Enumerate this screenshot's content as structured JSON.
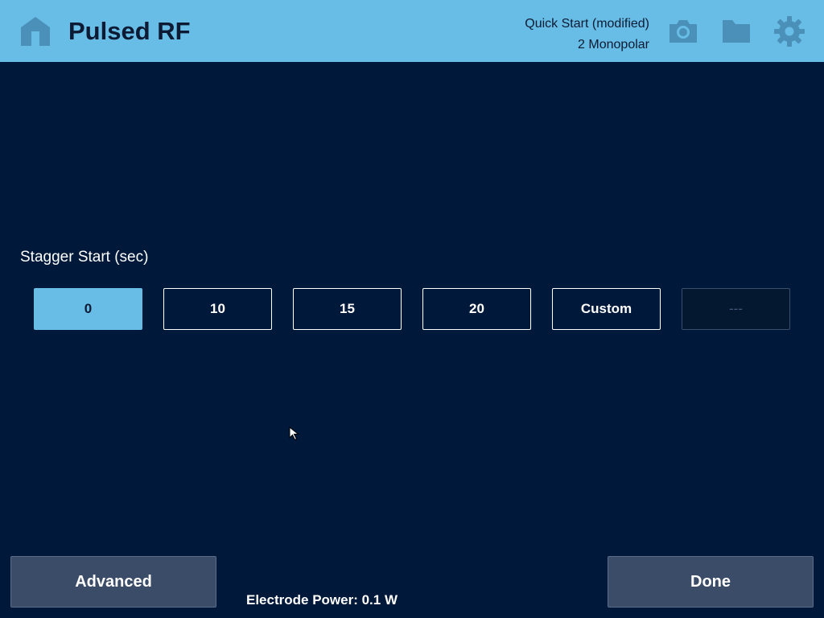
{
  "header": {
    "title": "Pulsed RF",
    "preset_name": "Quick Start (modified)",
    "preset_mode": "2 Monopolar",
    "icons": [
      "home-icon",
      "camera-icon",
      "folder-icon",
      "gear-icon"
    ],
    "background_color": "#67bde6"
  },
  "stagger": {
    "label": "Stagger Start (sec)",
    "options": [
      {
        "label": "0",
        "state": "selected"
      },
      {
        "label": "10",
        "state": "normal"
      },
      {
        "label": "15",
        "state": "normal"
      },
      {
        "label": "20",
        "state": "normal"
      },
      {
        "label": "Custom",
        "state": "normal"
      },
      {
        "label": "---",
        "state": "disabled"
      }
    ]
  },
  "footer": {
    "advanced_label": "Advanced",
    "done_label": "Done",
    "power_text": "Electrode Power: 0.1 W"
  },
  "colors": {
    "background": "#00183a",
    "accent": "#67bde6",
    "footer_button": "#3b4c68"
  }
}
